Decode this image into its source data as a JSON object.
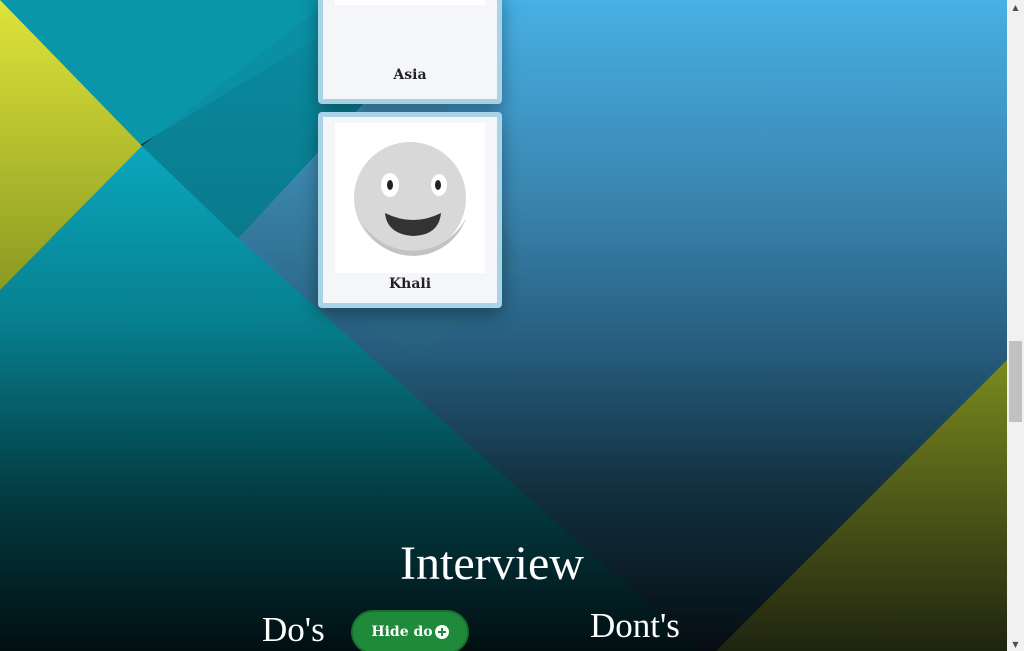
{
  "cards": [
    {
      "name": "Asia"
    },
    {
      "name": "Khali"
    }
  ],
  "section": {
    "title": "Interview",
    "dos_heading": "Do's",
    "donts_heading": "Dont's",
    "toggle_label": "Hide do"
  },
  "icons": {
    "avatar": "smiley-face-icon",
    "toggle": "plus-circle-icon",
    "scroll_up": "scroll-up-arrow-icon",
    "scroll_down": "scroll-down-arrow-icon"
  },
  "colors": {
    "accent_yellow": "#d4e03a",
    "button_green": "#1f8a3a",
    "card_border": "#a9d3e6"
  }
}
